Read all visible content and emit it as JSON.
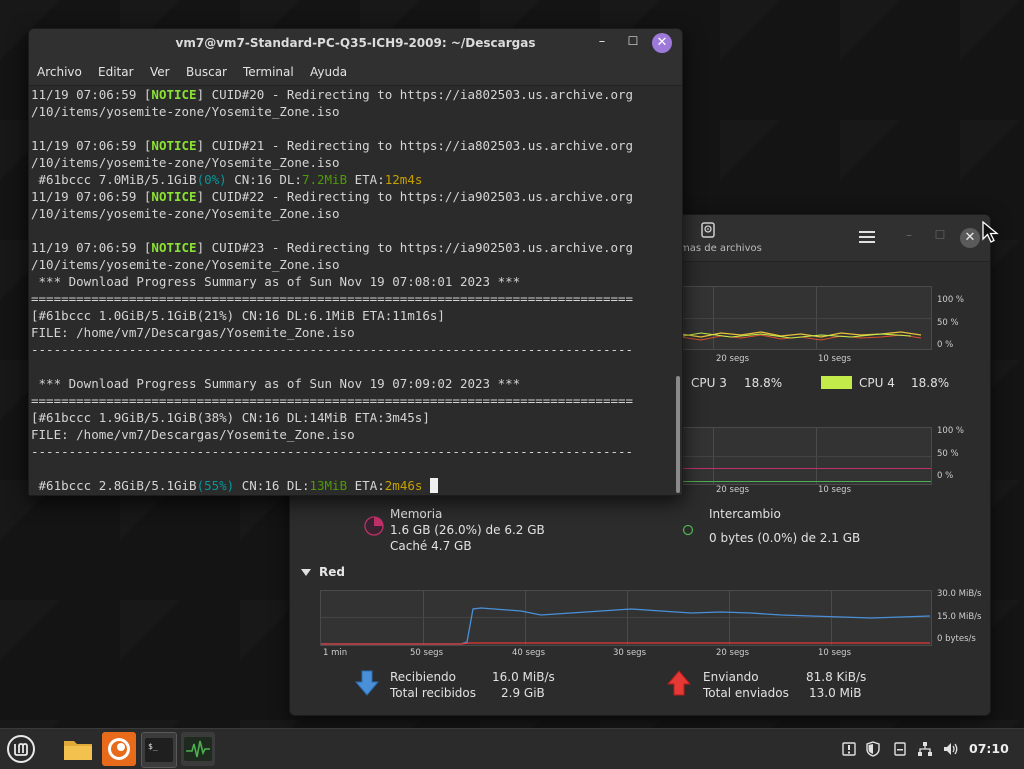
{
  "terminal": {
    "title": "vm7@vm7-Standard-PC-Q35-ICH9-2009: ~/Descargas",
    "menu": [
      "Archivo",
      "Editar",
      "Ver",
      "Buscar",
      "Terminal",
      "Ayuda"
    ],
    "lines": [
      {
        "segments": [
          {
            "t": "11/19 07:06:59 ["
          },
          {
            "t": "NOTICE",
            "c": "notice"
          },
          {
            "t": "] CUID#20 - Redirecting to https://ia802503.us.archive.org"
          }
        ]
      },
      {
        "segments": [
          {
            "t": "/10/items/yosemite-zone/Yosemite_Zone.iso"
          }
        ]
      },
      {
        "segments": [
          {
            "t": ""
          }
        ]
      },
      {
        "segments": [
          {
            "t": "11/19 07:06:59 ["
          },
          {
            "t": "NOTICE",
            "c": "notice"
          },
          {
            "t": "] CUID#21 - Redirecting to https://ia802503.us.archive.org"
          }
        ]
      },
      {
        "segments": [
          {
            "t": "/10/items/yosemite-zone/Yosemite_Zone.iso"
          }
        ]
      },
      {
        "segments": [
          {
            "t": " #61bccc 7.0MiB/5.1GiB"
          },
          {
            "t": "(0%)",
            "c": "pct"
          },
          {
            "t": " CN:16 DL:"
          },
          {
            "t": "7.2MiB",
            "c": "dl"
          },
          {
            "t": " ETA:"
          },
          {
            "t": "12m4s",
            "c": "eta"
          }
        ]
      },
      {
        "segments": [
          {
            "t": "11/19 07:06:59 ["
          },
          {
            "t": "NOTICE",
            "c": "notice"
          },
          {
            "t": "] CUID#22 - Redirecting to https://ia902503.us.archive.org"
          }
        ]
      },
      {
        "segments": [
          {
            "t": "/10/items/yosemite-zone/Yosemite_Zone.iso"
          }
        ]
      },
      {
        "segments": [
          {
            "t": ""
          }
        ]
      },
      {
        "segments": [
          {
            "t": "11/19 07:06:59 ["
          },
          {
            "t": "NOTICE",
            "c": "notice"
          },
          {
            "t": "] CUID#23 - Redirecting to https://ia902503.us.archive.org"
          }
        ]
      },
      {
        "segments": [
          {
            "t": "/10/items/yosemite-zone/Yosemite_Zone.iso"
          }
        ]
      },
      {
        "segments": [
          {
            "t": " *** Download Progress Summary as of Sun Nov 19 07:08:01 2023 ***"
          }
        ]
      },
      {
        "segments": [
          {
            "t": "================================================================================"
          }
        ]
      },
      {
        "segments": [
          {
            "t": "[#61bccc 1.0GiB/5.1GiB(21%) CN:16 DL:6.1MiB ETA:11m16s]"
          }
        ]
      },
      {
        "segments": [
          {
            "t": "FILE: /home/vm7/Descargas/Yosemite_Zone.iso"
          }
        ]
      },
      {
        "segments": [
          {
            "t": "--------------------------------------------------------------------------------"
          }
        ]
      },
      {
        "segments": [
          {
            "t": ""
          }
        ]
      },
      {
        "segments": [
          {
            "t": " *** Download Progress Summary as of Sun Nov 19 07:09:02 2023 ***"
          }
        ]
      },
      {
        "segments": [
          {
            "t": "================================================================================"
          }
        ]
      },
      {
        "segments": [
          {
            "t": "[#61bccc 1.9GiB/5.1GiB(38%) CN:16 DL:14MiB ETA:3m45s]"
          }
        ]
      },
      {
        "segments": [
          {
            "t": "FILE: /home/vm7/Descargas/Yosemite_Zone.iso"
          }
        ]
      },
      {
        "segments": [
          {
            "t": "--------------------------------------------------------------------------------"
          }
        ]
      },
      {
        "segments": [
          {
            "t": ""
          }
        ]
      },
      {
        "segments": [
          {
            "t": " #61bccc 2.8GiB/5.1GiB"
          },
          {
            "t": "(55%)",
            "c": "pct"
          },
          {
            "t": " CN:16 DL:"
          },
          {
            "t": "13MiB",
            "c": "dl"
          },
          {
            "t": " ETA:"
          },
          {
            "t": "2m46s",
            "c": "eta"
          },
          {
            "t": " "
          },
          {
            "t": "",
            "c": "cursor"
          }
        ]
      }
    ]
  },
  "sysmon": {
    "tab_label": "mas de archivos",
    "cpu": {
      "y_ticks": [
        "100 %",
        "50 %",
        "0 %"
      ],
      "x_ticks": [
        "20 segs",
        "10 segs"
      ],
      "legend": [
        {
          "name": "CPU 3",
          "value": "18.8%",
          "color": "#e8c13b"
        },
        {
          "name": "CPU 4",
          "value": "18.8%",
          "color": "#c3ec4a"
        }
      ]
    },
    "memory": {
      "y_ticks": [
        "100 %",
        "50 %",
        "0 %"
      ],
      "x_ticks": [
        "20 segs",
        "10 segs"
      ],
      "title": "Memoria",
      "line1": "1.6 GB (26.0%) de 6.2 GB",
      "line2": "Caché 4.7 GB",
      "swap_title": "Intercambio",
      "swap_line": "0 bytes (0.0%) de 2.1 GB",
      "mem_color": "#c0306a",
      "swap_color": "#4caf50",
      "mem_fraction": 0.26,
      "swap_fraction": 0.0
    },
    "network": {
      "section": "Red",
      "y_ticks": [
        "30.0 MiB/s",
        "15.0 MiB/s",
        "0 bytes/s"
      ],
      "x_ticks": [
        "1 min",
        "50 segs",
        "40 segs",
        "30 segs",
        "20 segs",
        "10 segs"
      ],
      "recv_label": "Recibiendo",
      "recv_value": "16.0 MiB/s",
      "recv_total_label": "Total recibidos",
      "recv_total_value": "2.9 GiB",
      "send_label": "Enviando",
      "send_value": "81.8 KiB/s",
      "send_total_label": "Total enviados",
      "send_total_value": "13.0 MiB",
      "recv_color": "#4a90d9",
      "send_color": "#e53935"
    }
  },
  "taskbar": {
    "apps": [
      "menu-icon",
      "files-icon",
      "firefox-icon",
      "terminal-icon",
      "system-monitor-icon"
    ],
    "clock": "07:10"
  }
}
